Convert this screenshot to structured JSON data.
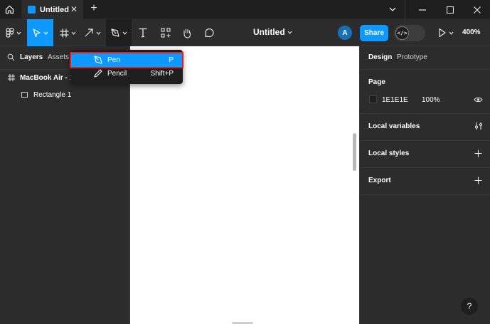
{
  "titlebar": {
    "tab_title": "Untitled",
    "tab_close": "✕",
    "tab_add": "+"
  },
  "toolbar": {
    "file_name": "Untitled",
    "avatar_initial": "A",
    "share_label": "Share",
    "dev_mode_glyph": "</>",
    "zoom_level": "400%"
  },
  "left_panel": {
    "tabs": [
      "Layers",
      "Assets"
    ],
    "layers": [
      {
        "label": "MacBook Air - 1",
        "type": "frame"
      },
      {
        "label": "Rectangle 1",
        "type": "rectangle"
      }
    ]
  },
  "tool_menu": {
    "items": [
      {
        "label": "Pen",
        "shortcut": "P",
        "highlighted": true
      },
      {
        "label": "Pencil",
        "shortcut": "Shift+P",
        "highlighted": false
      }
    ]
  },
  "right_panel": {
    "tabs": [
      "Design",
      "Prototype"
    ],
    "page_heading": "Page",
    "page_color": "1E1E1E",
    "page_opacity": "100%",
    "sections": [
      "Local variables",
      "Local styles",
      "Export"
    ]
  },
  "help": {
    "label": "?"
  },
  "colors": {
    "accent": "#0d99ff",
    "highlight_outline": "#e01e1e",
    "panel_bg": "#2c2c2c",
    "titlebar_bg": "#1e1e1e"
  }
}
